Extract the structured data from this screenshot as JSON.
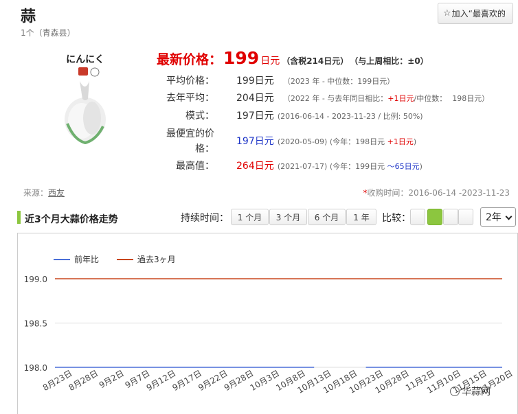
{
  "header": {
    "title": "蒜",
    "subtitle": "1个（青森县）",
    "favorite_label": "加入“最喜欢的"
  },
  "product": {
    "image_text": "にんにく"
  },
  "latest": {
    "label": "最新价格：",
    "price": "199",
    "unit": "日元",
    "tax": "（含税214日元）",
    "weekly": "（与上周相比：±0）"
  },
  "stats": {
    "average": {
      "label": "平均价格：",
      "value": "199日元",
      "note": "（2023 年 - 中位数：199日元）"
    },
    "last_year": {
      "label": "去年平均：",
      "value": "204日元",
      "note_a": "（2022 年 - 与去年同日相比：",
      "note_diff": "+1日元",
      "note_b": "/中位数：",
      "note_median": "198日元）"
    },
    "mode": {
      "label": "模式：",
      "value": "197日元",
      "note": "(2016-06-14 - 2023-11-23 / 比例: 50%)"
    },
    "cheapest": {
      "label_1": "最便宜的价",
      "label_2": "格：",
      "value": "197日元",
      "note_a": "(2020-05-09) (今年：198日元 ",
      "note_diff": "+1日元",
      "note_b": ")"
    },
    "highest": {
      "label": "最高值：",
      "value": "264日元",
      "note_a": "(2021-07-17) (今年：199日元 ",
      "note_diff": "～65日元",
      "note_b": ")"
    }
  },
  "source": {
    "label": "来源：",
    "link": "西友"
  },
  "collect": {
    "star": "*",
    "text": "收购时间：2016-06-14 -2023-11-23"
  },
  "controls": {
    "section_title": "近3个月大蒜价格走势",
    "duration_label": "持续时间：",
    "tabs": [
      "1 个月",
      "3 个月",
      "6 个月",
      "1 年"
    ],
    "compare_label": "比较：",
    "compare_active_index": 1,
    "year_select": "2年"
  },
  "watermark": "华蒜网",
  "colors": {
    "accent_green": "#8cc63f",
    "price_red": "#e00000",
    "link_blue": "#1f36c7",
    "series_blue": "#4a6fd8",
    "series_orange": "#c8461d"
  },
  "chart_data": {
    "type": "line",
    "title": "",
    "x": [
      "8月23日",
      "8月28日",
      "9月2日",
      "9月7日",
      "9月12日",
      "9月17日",
      "9月22日",
      "9月28日",
      "10月3日",
      "10月8日",
      "10月13日",
      "10月18日",
      "10月23日",
      "10月28日",
      "11月2日",
      "11月10日",
      "11月15日",
      "11月20日"
    ],
    "series": [
      {
        "name": "前年比",
        "color": "#4a6fd8",
        "values": [
          198,
          198,
          198,
          198,
          198,
          198,
          198,
          198,
          198,
          198,
          198,
          null,
          198,
          198,
          198,
          198,
          198,
          198
        ]
      },
      {
        "name": "過去3ヶ月",
        "color": "#c8461d",
        "values": [
          199,
          199,
          199,
          199,
          199,
          199,
          199,
          199,
          199,
          199,
          199,
          199,
          199,
          199,
          199,
          199,
          199,
          199
        ]
      }
    ],
    "ylim": [
      198,
      199
    ],
    "yticks": [
      "198.0",
      "198.5",
      "199.0"
    ],
    "grid": true,
    "legend": "top-left"
  }
}
